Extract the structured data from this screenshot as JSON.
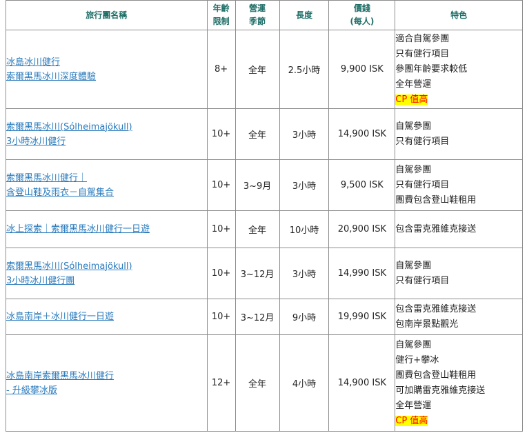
{
  "headers": {
    "name": "旅行團名稱",
    "age": [
      "年齡",
      "限制"
    ],
    "season": [
      "營運",
      "季節"
    ],
    "length": "長度",
    "price": [
      "價錢",
      "(每人)"
    ],
    "features": "特色"
  },
  "rows": [
    {
      "name": [
        "冰島冰川健行",
        "索爾黑馬冰川深度體驗"
      ],
      "age": "8+",
      "season": "全年",
      "length": "2.5小時",
      "price": "9,900 ISK",
      "features": [
        "適合自駕參團",
        "只有健行項目",
        "參團年齡要求較低",
        "全年營運"
      ],
      "badge": "CP 值高"
    },
    {
      "name": [
        "索爾黑馬冰川(Sólheimajökull)",
        "3小時冰川健行"
      ],
      "age": "10+",
      "season": "全年",
      "length": "3小時",
      "price": "14,900 ISK",
      "features": [
        "自駕參團",
        "只有健行項目"
      ],
      "badge": ""
    },
    {
      "name": [
        "索爾黑馬冰川健行｜",
        "含登山鞋及雨衣－自駕集合"
      ],
      "age": "10+",
      "season": "3~9月",
      "length": "3小時",
      "price": "9,500 ISK",
      "features": [
        "自駕參團",
        "只有健行項目",
        "團費包含登山鞋租用"
      ],
      "badge": ""
    },
    {
      "name": [
        "冰上探索｜索爾黑馬冰川健行一日遊"
      ],
      "age": "10+",
      "season": "全年",
      "length": "10小時",
      "price": "20,900 ISK",
      "features": [
        "包含雷克雅維克接送"
      ],
      "badge": ""
    },
    {
      "name": [
        "索爾黑馬冰川(Sólheimajökull)",
        "3小時冰川健行團"
      ],
      "age": "10+",
      "season": "3~12月",
      "length": "3小時",
      "price": "14,990 ISK",
      "features": [
        "自駕參團",
        "只有健行項目"
      ],
      "badge": ""
    },
    {
      "name": [
        "冰島南岸＋冰川健行一日遊"
      ],
      "age": "10+",
      "season": "3~12月",
      "length": "9小時",
      "price": "19,990 ISK",
      "features": [
        "包含雷克雅維克接送",
        "包南岸景點觀光"
      ],
      "badge": ""
    },
    {
      "name": [
        "冰島南岸索爾黑馬冰川健行",
        "- 升級攀冰版"
      ],
      "age": "12+",
      "season": "全年",
      "length": "4小時",
      "price": "14,900 ISK",
      "features": [
        "自駕參團",
        "健行+攀冰",
        "團費包含登山鞋租用",
        "可加購雷克雅維克接送",
        "全年營運"
      ],
      "badge": "CP 值高"
    }
  ]
}
